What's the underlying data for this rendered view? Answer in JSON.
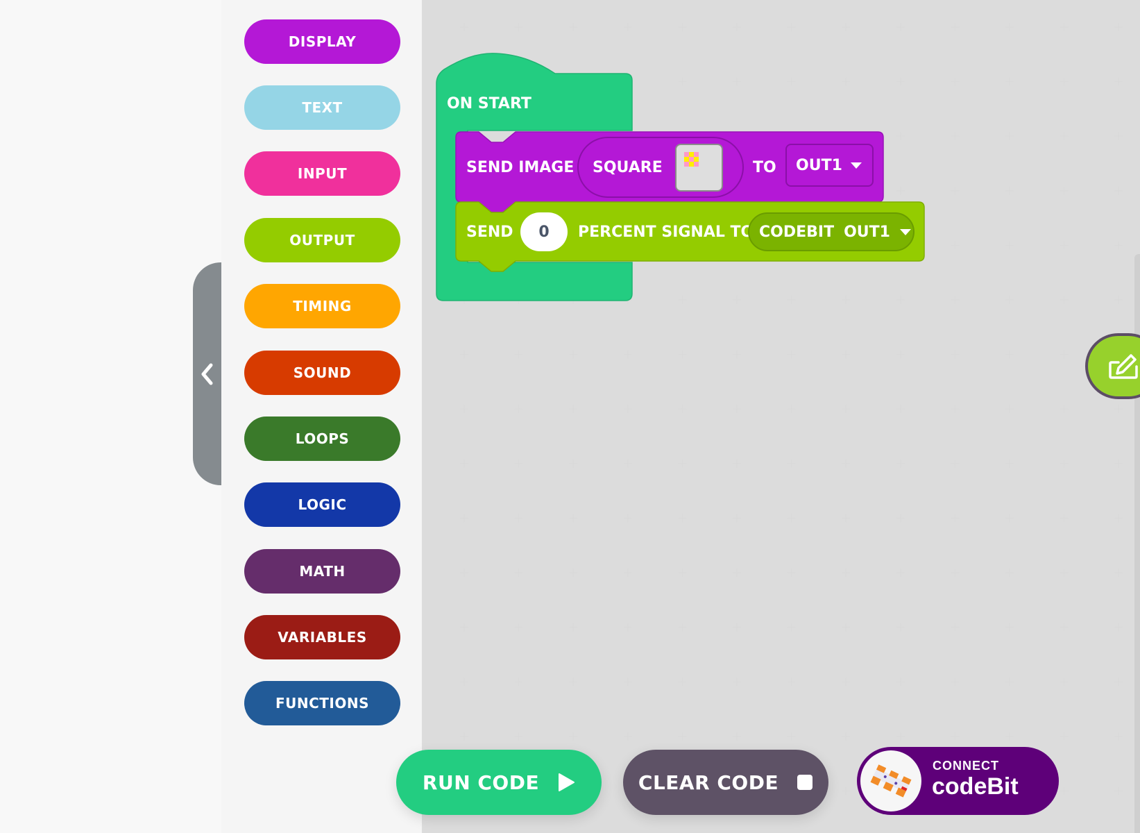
{
  "sidebar": {
    "categories": [
      {
        "label": "DISPLAY",
        "color": "#b418d6"
      },
      {
        "label": "TEXT",
        "color": "#95d5e6"
      },
      {
        "label": "INPUT",
        "color": "#f0309c"
      },
      {
        "label": "OUTPUT",
        "color": "#94cc00"
      },
      {
        "label": "TIMING",
        "color": "#ffa601"
      },
      {
        "label": "SOUND",
        "color": "#d73b00"
      },
      {
        "label": "LOOPS",
        "color": "#3a7a2a"
      },
      {
        "label": "LOGIC",
        "color": "#1338a8"
      },
      {
        "label": "MATH",
        "color": "#652d6b"
      },
      {
        "label": "VARIABLES",
        "color": "#9b1c15"
      },
      {
        "label": "FUNCTIONS",
        "color": "#225b98"
      }
    ],
    "collapse_icon": "chevron-left-icon"
  },
  "workspace": {
    "hat_block": {
      "label": "ON START",
      "color": "#23cd81"
    },
    "send_image_block": {
      "label": "SEND IMAGE",
      "image_name": "SQUARE",
      "to_label": "TO",
      "target": "OUT1",
      "color": "#b418d6",
      "image_colors": [
        "#ff99c8",
        "#ffee00"
      ]
    },
    "signal_block": {
      "label": "SEND",
      "value": "0",
      "suffix": "PERCENT SIGNAL TO",
      "device": "CODEBIT",
      "target": "OUT1",
      "color": "#94cc00"
    }
  },
  "toolbar": {
    "run_label": "RUN CODE",
    "run_color": "#23cd81",
    "clear_label": "CLEAR CODE",
    "clear_color": "#5e5266",
    "connect_small": "CONNECT",
    "connect_big": "codeBit",
    "connect_color": "#5e0079"
  },
  "edit_button": {
    "icon": "edit-icon",
    "color": "#97d12c"
  }
}
